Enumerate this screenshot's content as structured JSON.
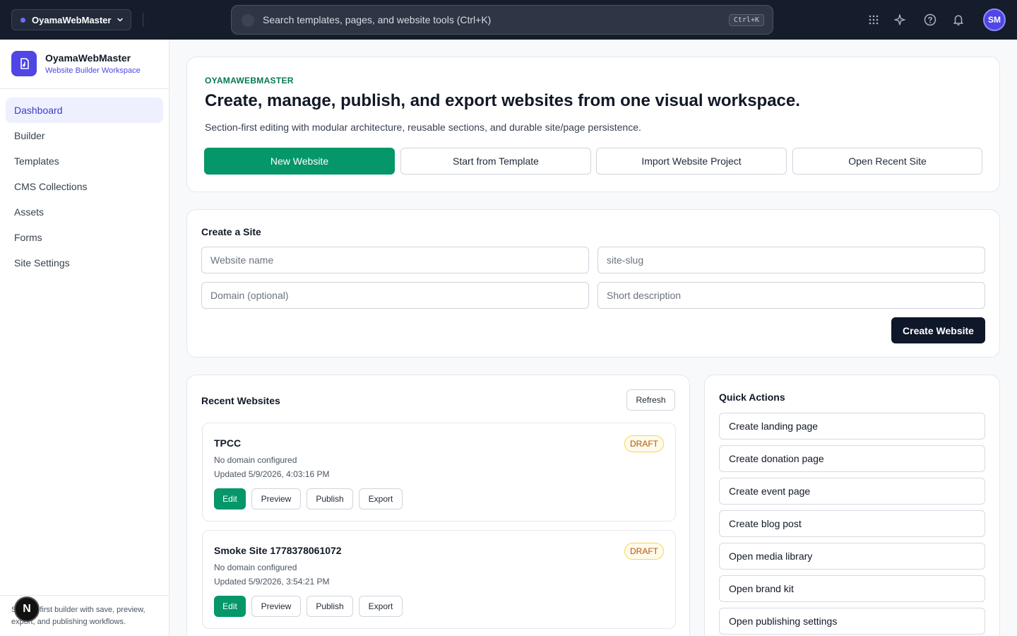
{
  "topbar": {
    "workspace": "OyamaWebMaster",
    "search_placeholder": "Search templates, pages, and website tools (Ctrl+K)",
    "shortcut": "Ctrl+K",
    "avatar_initials": "SM"
  },
  "sidebar": {
    "brand_name": "OyamaWebMaster",
    "brand_sub": "Website Builder Workspace",
    "items": [
      {
        "label": "Dashboard"
      },
      {
        "label": "Builder"
      },
      {
        "label": "Templates"
      },
      {
        "label": "CMS Collections"
      },
      {
        "label": "Assets"
      },
      {
        "label": "Forms"
      },
      {
        "label": "Site Settings"
      }
    ],
    "footer_text": "Section-first builder with save, preview, export, and publishing workflows.",
    "badge_letter": "N"
  },
  "hero": {
    "eyebrow": "OYAMAWEBMASTER",
    "title": "Create, manage, publish, and export websites from one visual workspace.",
    "subtitle": "Section-first editing with modular architecture, reusable sections, and durable site/page persistence.",
    "buttons": [
      "New Website",
      "Start from Template",
      "Import Website Project",
      "Open Recent Site"
    ]
  },
  "create_site": {
    "title": "Create a Site",
    "placeholders": {
      "name": "Website name",
      "slug": "site-slug",
      "domain": "Domain (optional)",
      "description": "Short description"
    },
    "submit": "Create Website"
  },
  "recent": {
    "title": "Recent Websites",
    "refresh": "Refresh",
    "sites": [
      {
        "name": "TPCC",
        "domain": "No domain configured",
        "updated": "Updated 5/9/2026, 4:03:16 PM",
        "status": "DRAFT"
      },
      {
        "name": "Smoke Site 1778378061072",
        "domain": "No domain configured",
        "updated": "Updated 5/9/2026, 3:54:21 PM",
        "status": "DRAFT"
      }
    ],
    "actions": [
      "Edit",
      "Preview",
      "Publish",
      "Export"
    ]
  },
  "quick_actions": {
    "title": "Quick Actions",
    "items": [
      "Create landing page",
      "Create donation page",
      "Create event page",
      "Create blog post",
      "Open media library",
      "Open brand kit",
      "Open publishing settings"
    ]
  },
  "colors": {
    "topbar": "#151c2b",
    "accent": "#4f46e5",
    "primary_green": "#059669",
    "dark_button": "#0f172a"
  }
}
